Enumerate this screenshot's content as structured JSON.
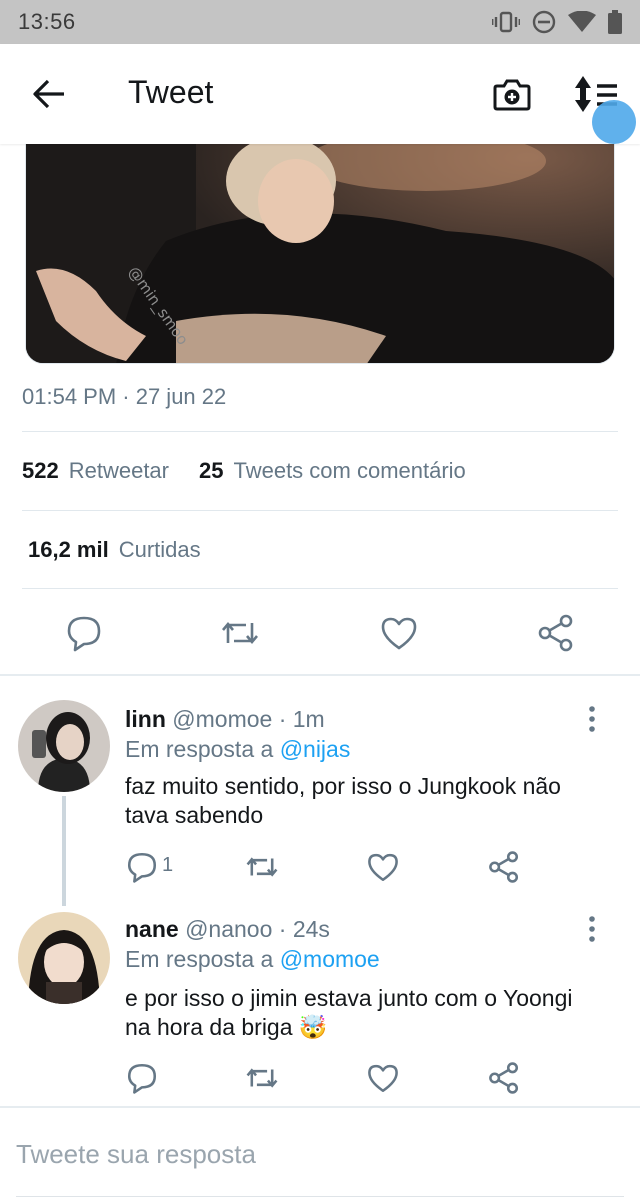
{
  "status_bar": {
    "time": "13:56",
    "icons": [
      "vibrate-icon",
      "do-not-disturb-icon",
      "wifi-icon",
      "battery-icon"
    ]
  },
  "app_bar": {
    "title": "Tweet",
    "icons": [
      "back-arrow-icon",
      "camera-plus-icon",
      "sort-icon"
    ]
  },
  "tweet": {
    "media_watermark": "@min_smoo",
    "timestamp": "01:54 PM · 27 jun 22",
    "retweets_count": "522",
    "retweets_label": "Retweetar",
    "quote_count": "25",
    "quote_label": "Tweets com comentário",
    "likes_count": "16,2 mil",
    "likes_label": "Curtidas",
    "actions": [
      "reply-icon",
      "retweet-icon",
      "like-icon",
      "share-icon"
    ]
  },
  "replies": [
    {
      "name": "linn",
      "handle": "@momoe",
      "time": "· 1m",
      "reply_prefix": "Em resposta a",
      "reply_to": "@nijas",
      "text": "faz muito sentido, por isso o Jungkook não tava sabendo",
      "reply_count": "1"
    },
    {
      "name": "nane",
      "handle": "@nanoo",
      "time": "· 24s",
      "reply_prefix": "Em resposta a",
      "reply_to": "@momoe",
      "text": "e por isso o jimin estava junto com o Yoongi na hora da briga",
      "emoji": "🤯",
      "reply_count": ""
    }
  ],
  "compose": {
    "placeholder": "Tweete sua resposta"
  },
  "colors": {
    "accent": "#1da1f2",
    "secondary_text": "#657786",
    "primary_text": "#14171a",
    "status_bar": "#c4c4c4",
    "highlight": "#4fa9ea"
  }
}
